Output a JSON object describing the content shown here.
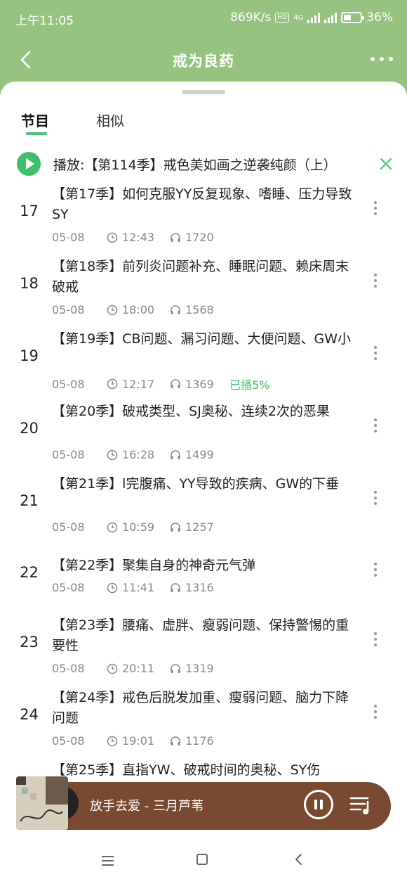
{
  "status_bar": {
    "time": "上午11:05",
    "speed": "869K/s",
    "hd": "HD",
    "network": "4G",
    "battery": "36%"
  },
  "header": {
    "title": "戒为良药",
    "back_icon": "chevron-left-icon",
    "more_icon": "more-horizontal-icon"
  },
  "tabs": [
    {
      "label": "节目",
      "active": true
    },
    {
      "label": "相似",
      "active": false
    }
  ],
  "now_playing": {
    "text": "播放:【第114季】戒色美如画之逆袭纯颜（上）",
    "play_icon": "play-icon",
    "close_icon": "close-icon"
  },
  "episodes": [
    {
      "num": "17",
      "title": "【第17季】如何克服YY反复现象、嗜睡、压力导致SY",
      "date": "05-08",
      "duration": "12:43",
      "plays": "1720",
      "played": ""
    },
    {
      "num": "18",
      "title": "【第18季】前列炎问题补充、睡眠问题、赖床周末破戒",
      "date": "05-08",
      "duration": "18:00",
      "plays": "1568",
      "played": ""
    },
    {
      "num": "19",
      "title": "【第19季】CB问题、漏习问题、大便问题、GW小",
      "date": "05-08",
      "duration": "12:17",
      "plays": "1369",
      "played": "已播5%"
    },
    {
      "num": "20",
      "title": "【第20季】破戒类型、SJ奥秘、连续2次的恶果",
      "date": "05-08",
      "duration": "16:28",
      "plays": "1499",
      "played": ""
    },
    {
      "num": "21",
      "title": "【第21季】l完腹痛、YY导致的疾病、GW的下垂",
      "date": "05-08",
      "duration": "10:59",
      "plays": "1257",
      "played": ""
    },
    {
      "num": "22",
      "title": "【第22季】聚集自身的神奇元气弹",
      "date": "05-08",
      "duration": "11:41",
      "plays": "1316",
      "played": ""
    },
    {
      "num": "23",
      "title": "【第23季】腰痛、虚胖、瘦弱问题、保持警惕的重要性",
      "date": "05-08",
      "duration": "20:11",
      "plays": "1319",
      "played": ""
    },
    {
      "num": "24",
      "title": "【第24季】戒色后脱发加重、瘦弱问题、脑力下降问题",
      "date": "05-08",
      "duration": "19:01",
      "plays": "1176",
      "played": ""
    },
    {
      "num": "",
      "title": "【第25季】直指YW、破戒时间的奥秘、SY伤",
      "date": "",
      "duration": "",
      "plays": "",
      "played": ""
    }
  ],
  "player": {
    "title": "放手去爱 - 三月芦苇",
    "pause_icon": "pause-icon",
    "playlist_icon": "playlist-icon"
  },
  "nav": {
    "menu_icon": "menu-icon",
    "home_icon": "home-icon",
    "back_icon": "back-icon"
  },
  "colors": {
    "header_bg": "#97c380",
    "accent": "#3ec06a",
    "player_bg": "#7a4931"
  }
}
